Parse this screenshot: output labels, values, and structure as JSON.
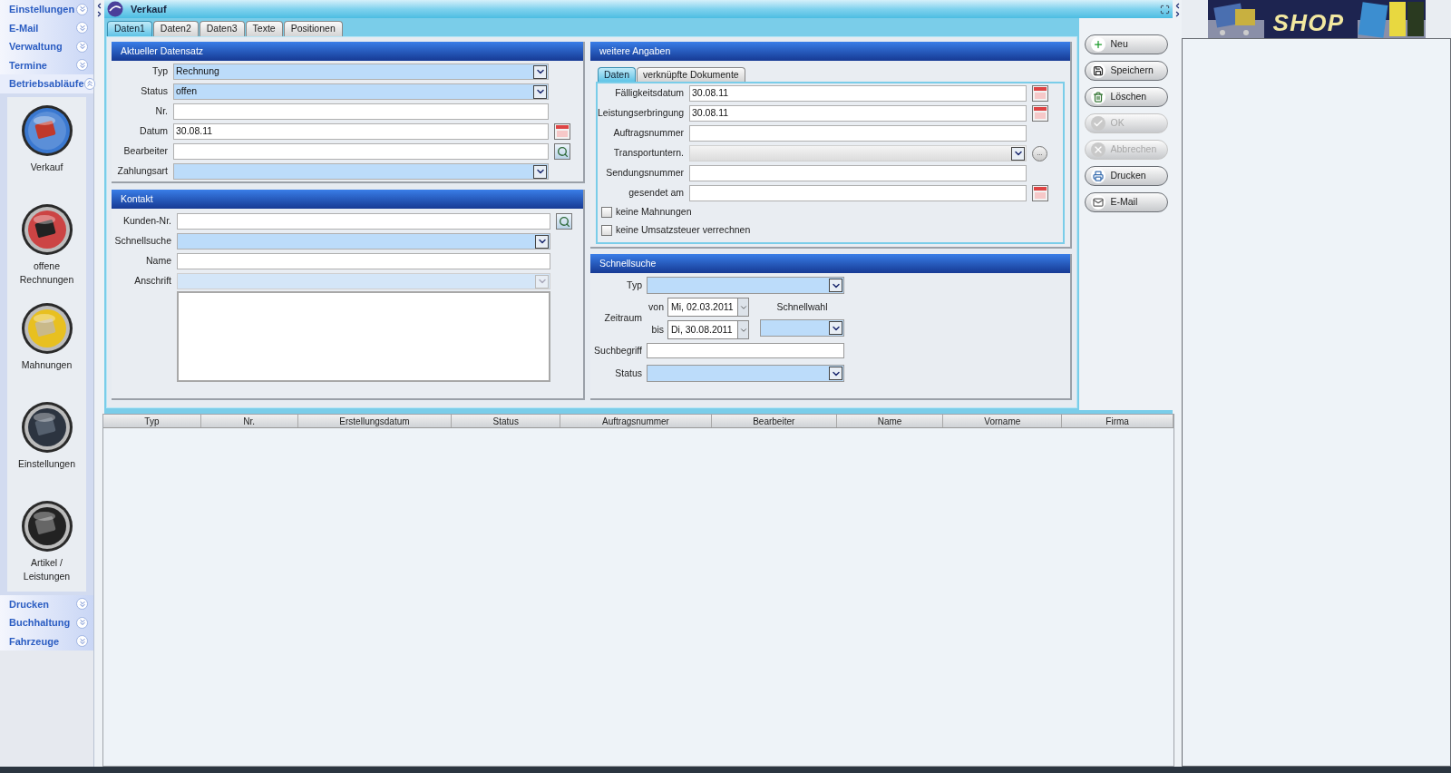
{
  "sidebar": {
    "top_groups": [
      {
        "label": "Einstellungen",
        "expanded": false
      },
      {
        "label": "E-Mail",
        "expanded": false
      },
      {
        "label": "Verwaltung",
        "expanded": false
      },
      {
        "label": "Termine",
        "expanded": false
      },
      {
        "label": "Betriebsabläufe",
        "expanded": true
      }
    ],
    "modules": [
      {
        "label": "Verkauf",
        "kind": "sales",
        "selected": true
      },
      {
        "label": "offene Rechnungen",
        "kind": "invoices",
        "selected": false
      },
      {
        "label": "Mahnungen",
        "kind": "reminders",
        "selected": false
      },
      {
        "label": "Einstellungen",
        "kind": "settings",
        "selected": false
      },
      {
        "label": "Artikel / Leistungen",
        "kind": "articles",
        "selected": false
      }
    ],
    "bottom_groups": [
      {
        "label": "Drucken",
        "expanded": false
      },
      {
        "label": "Buchhaltung",
        "expanded": false
      },
      {
        "label": "Fahrzeuge",
        "expanded": false
      }
    ]
  },
  "window": {
    "title": "Verkauf"
  },
  "tabs": [
    {
      "label": "Daten1",
      "selected": true
    },
    {
      "label": "Daten2",
      "selected": false
    },
    {
      "label": "Daten3",
      "selected": false
    },
    {
      "label": "Texte",
      "selected": false
    },
    {
      "label": "Positionen",
      "selected": false
    }
  ],
  "aktueller_datensatz": {
    "title": "Aktueller Datensatz",
    "fields": [
      {
        "label": "Typ",
        "kind": "select",
        "value": "Rechnung",
        "disabled": false
      },
      {
        "label": "Status",
        "kind": "select",
        "value": "offen",
        "disabled": false
      },
      {
        "label": "Nr.",
        "kind": "text",
        "disabled": false
      },
      {
        "label": "Datum",
        "kind": "date",
        "value": "30.08.11",
        "disabled": false
      },
      {
        "label": "Bearbeiter",
        "kind": "lookup",
        "disabled": false
      },
      {
        "label": "Zahlungsart",
        "kind": "select",
        "disabled": false
      }
    ]
  },
  "kontakt": {
    "title": "Kontakt",
    "fields": [
      {
        "label": "Kunden-Nr.",
        "kind": "lookup",
        "disabled": false
      },
      {
        "label": "Schnellsuche",
        "kind": "select",
        "disabled": false
      },
      {
        "label": "Name",
        "kind": "text",
        "disabled": false
      },
      {
        "label": "Anschrift",
        "kind": "select",
        "disabled": true
      },
      {
        "kind": "textarea",
        "disabled": false
      }
    ]
  },
  "weitere_angaben": {
    "title": "weitere Angaben",
    "tabs": [
      {
        "label": "Daten",
        "selected": true
      },
      {
        "label": "verknüpfte Dokumente",
        "selected": false
      }
    ],
    "fields": [
      {
        "label": "Fälligkeitsdatum",
        "kind": "date",
        "value": "30.08.11",
        "disabled": false
      },
      {
        "label": "Leistungserbringung",
        "kind": "date",
        "value": "30.08.11",
        "disabled": false
      },
      {
        "label": "Auftragsnummer",
        "kind": "text",
        "disabled": false
      },
      {
        "label": "Transportuntern.",
        "kind": "select",
        "disabled": true,
        "extra_button": "..."
      },
      {
        "label": "Sendungsnummer",
        "kind": "text",
        "disabled": false
      },
      {
        "label": "gesendet am",
        "kind": "date",
        "disabled": false
      }
    ],
    "checkboxes": [
      {
        "label": "keine Mahnungen",
        "checked": false
      },
      {
        "label": "keine Umsatzsteuer verrechnen",
        "checked": false
      }
    ]
  },
  "schnellsuche": {
    "title": "Schnellsuche",
    "typ_label": "Typ",
    "zeitraum_label": "Zeitraum",
    "von_label": "von",
    "von_value": "Mi, 02.03.2011",
    "bis_label": "bis",
    "bis_value": "Di, 30.08.2011",
    "schnellwahl_label": "Schnellwahl",
    "suchbegriff_label": "Suchbegriff",
    "status_label": "Status"
  },
  "buttons": [
    {
      "label": "Neu",
      "kind": "new",
      "disabled": false
    },
    {
      "label": "Speichern",
      "kind": "save",
      "disabled": false
    },
    {
      "label": "Löschen",
      "kind": "delete",
      "disabled": false
    },
    {
      "label": "OK",
      "kind": "ok",
      "disabled": true
    },
    {
      "label": "Abbrechen",
      "kind": "cancel",
      "disabled": true
    },
    {
      "label": "Drucken",
      "kind": "print",
      "disabled": false
    },
    {
      "label": "E-Mail",
      "kind": "email",
      "disabled": false
    }
  ],
  "table": {
    "columns": [
      "Typ",
      "Nr.",
      "Erstellungsdatum",
      "Status",
      "Auftragsnummer",
      "Bearbeiter",
      "Name",
      "Vorname",
      "Firma"
    ]
  },
  "shop_banner": {
    "text": "SHOP"
  }
}
